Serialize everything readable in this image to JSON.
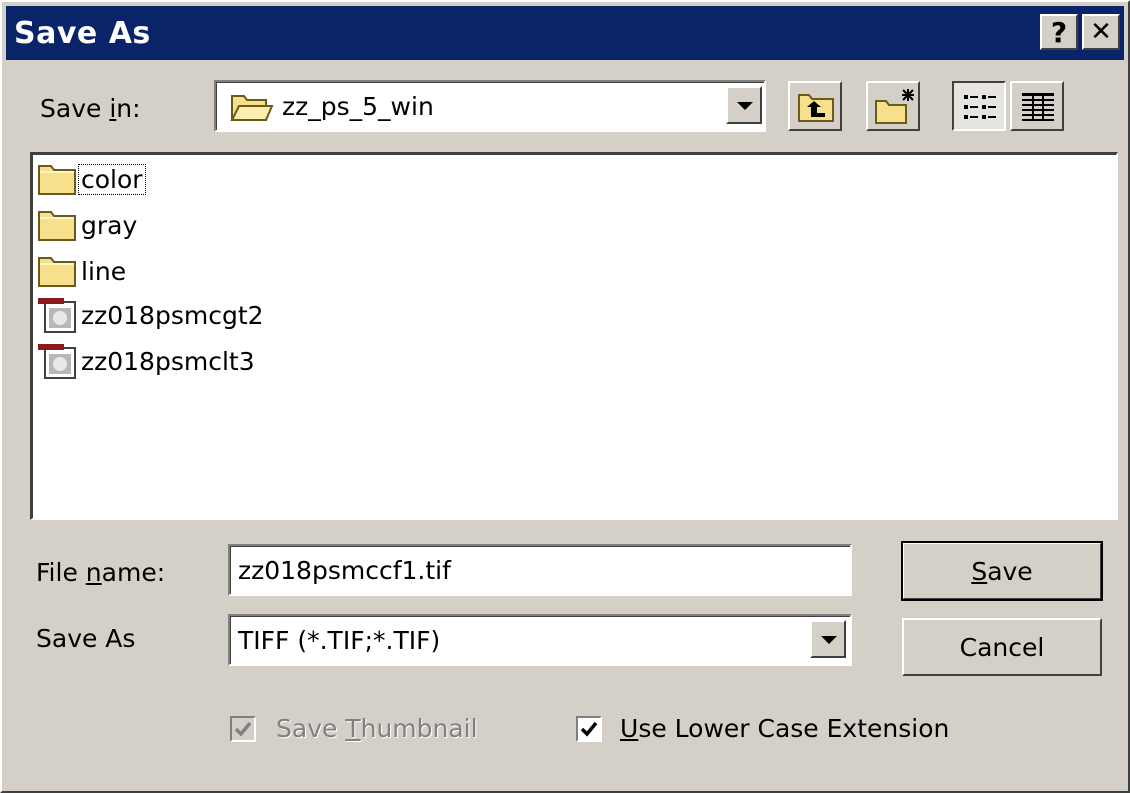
{
  "window": {
    "title": "Save As",
    "help_glyph": "?",
    "close_glyph": "✕"
  },
  "save_in": {
    "label_pre": "Save ",
    "label_mnemonic": "i",
    "label_post": "n:",
    "value": "zz_ps_5_win"
  },
  "toolbar": {
    "icons": [
      "up-one-level-icon",
      "create-new-folder-icon",
      "list-view-icon",
      "details-view-icon"
    ],
    "active_view": "list"
  },
  "files": [
    {
      "name": "color",
      "type": "folder",
      "focused": true
    },
    {
      "name": "gray",
      "type": "folder",
      "focused": false
    },
    {
      "name": "line",
      "type": "folder",
      "focused": false
    },
    {
      "name": "zz018psmcgt2",
      "type": "image-file",
      "focused": false
    },
    {
      "name": "zz018psmclt3",
      "type": "image-file",
      "focused": false
    }
  ],
  "file_name": {
    "label_pre": "File ",
    "label_mnemonic": "n",
    "label_post": "ame:",
    "value": "zz018psmccf1.tif"
  },
  "save_as_type": {
    "label": "Save As",
    "value": "TIFF (*.TIF;*.TIF)"
  },
  "buttons": {
    "save_mnemonic": "S",
    "save_rest": "ave",
    "cancel": "Cancel"
  },
  "options": {
    "thumbnail_pre": "Save ",
    "thumbnail_mnemonic": "T",
    "thumbnail_post": "humbnail",
    "thumbnail_checked": true,
    "thumbnail_disabled": true,
    "lowercase_mnemonic": "U",
    "lowercase_rest": "se Lower Case Extension",
    "lowercase_checked": true
  },
  "colors": {
    "titlebar": "#0a246a",
    "face": "#d4d0c8",
    "folder_yellow": "#f6e08c",
    "file_red": "#8b1a1a"
  }
}
